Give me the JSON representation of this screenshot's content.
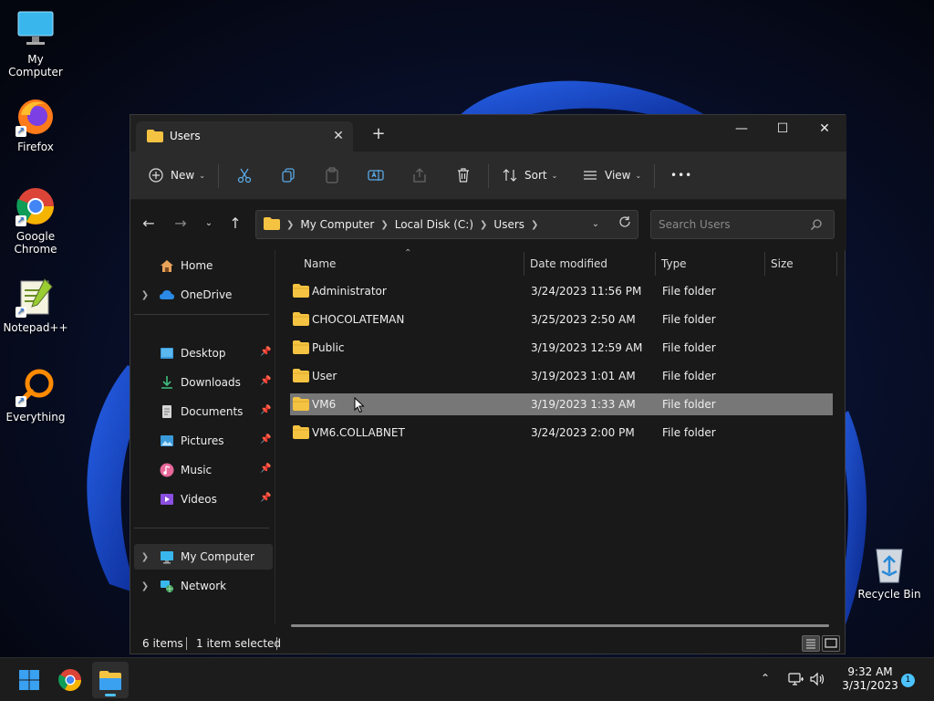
{
  "desktop": {
    "icons": [
      {
        "label": "My Computer",
        "icon": "monitor-icon"
      },
      {
        "label": "Firefox",
        "icon": "firefox-icon"
      },
      {
        "label": "Google Chrome",
        "icon": "chrome-icon"
      },
      {
        "label": "Notepad++",
        "icon": "notepadpp-icon"
      },
      {
        "label": "Everything",
        "icon": "everything-icon"
      },
      {
        "label": "Recycle Bin",
        "icon": "recycle-bin-icon"
      }
    ]
  },
  "window": {
    "tab_title": "Users",
    "new_tab_symbol": "+",
    "controls": {
      "minimize": "—",
      "maximize": "☐",
      "close": "✕"
    }
  },
  "commandbar": {
    "new_label": "New",
    "sort_label": "Sort",
    "view_label": "View",
    "more_label": "•••"
  },
  "address": {
    "crumbs": [
      "My Computer",
      "Local Disk (C:)",
      "Users"
    ],
    "search_placeholder": "Search Users"
  },
  "navpane": {
    "home": "Home",
    "onedrive": "OneDrive",
    "quick": [
      {
        "label": "Desktop",
        "icon": "desktop-icon"
      },
      {
        "label": "Downloads",
        "icon": "downloads-icon"
      },
      {
        "label": "Documents",
        "icon": "documents-icon"
      },
      {
        "label": "Pictures",
        "icon": "pictures-icon"
      },
      {
        "label": "Music",
        "icon": "music-icon"
      },
      {
        "label": "Videos",
        "icon": "videos-icon"
      }
    ],
    "mycomputer": "My Computer",
    "network": "Network"
  },
  "filelist": {
    "columns": {
      "name": "Name",
      "date": "Date modified",
      "type": "Type",
      "size": "Size"
    },
    "rows": [
      {
        "name": "Administrator",
        "date": "3/24/2023 11:56 PM",
        "type": "File folder",
        "selected": false
      },
      {
        "name": "CHOCOLATEMAN",
        "date": "3/25/2023 2:50 AM",
        "type": "File folder",
        "selected": false
      },
      {
        "name": "Public",
        "date": "3/19/2023 12:59 AM",
        "type": "File folder",
        "selected": false
      },
      {
        "name": "User",
        "date": "3/19/2023 1:01 AM",
        "type": "File folder",
        "selected": false
      },
      {
        "name": "VM6",
        "date": "3/19/2023 1:33 AM",
        "type": "File folder",
        "selected": true
      },
      {
        "name": "VM6.COLLABNET",
        "date": "3/24/2023 2:00 PM",
        "type": "File folder",
        "selected": false
      }
    ]
  },
  "status": {
    "items_count": "6 items",
    "selected_count": "1 item selected"
  },
  "taskbar": {
    "time": "9:32 AM",
    "date": "3/31/2023",
    "notifications": "1"
  },
  "colors": {
    "accent": "#4cc2ff",
    "folder": "#f5c342",
    "selection": "#777777"
  }
}
